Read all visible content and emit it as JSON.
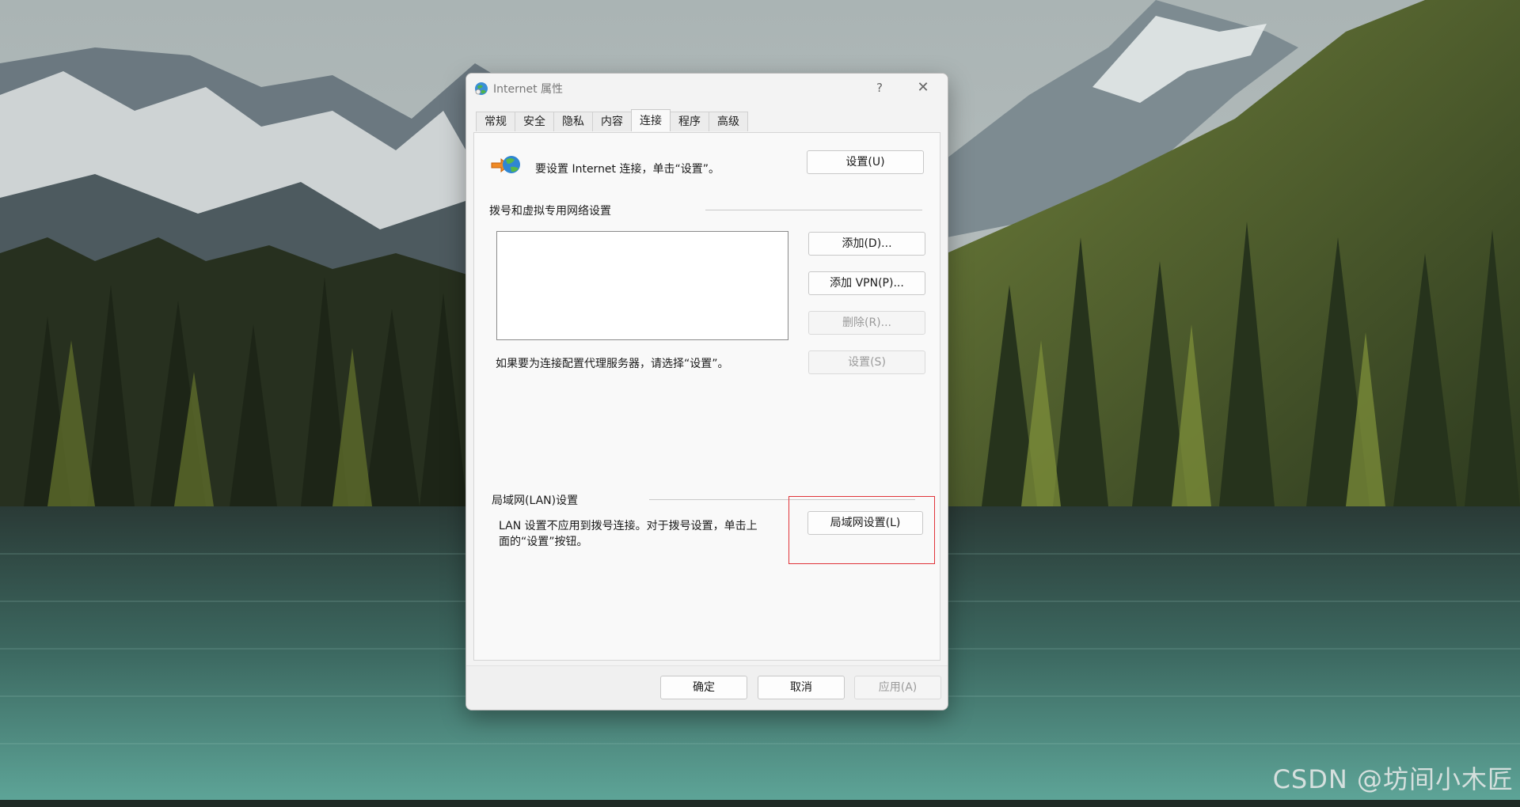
{
  "window": {
    "title": "Internet 属性",
    "help_label": "?",
    "close_label": "✕"
  },
  "tabs": [
    {
      "label": "常规"
    },
    {
      "label": "安全"
    },
    {
      "label": "隐私"
    },
    {
      "label": "内容"
    },
    {
      "label": "连接",
      "active": true
    },
    {
      "label": "程序"
    },
    {
      "label": "高级"
    }
  ],
  "connection": {
    "setup_text": "要设置 Internet 连接，单击“设置”。",
    "setup_button": "设置(U)"
  },
  "dialup": {
    "heading": "拨号和虚拟专用网络设置",
    "add_button": "添加(D)...",
    "add_vpn_button": "添加 VPN(P)...",
    "remove_button": "删除(R)...",
    "proxy_text": "如果要为连接配置代理服务器，请选择“设置”。",
    "settings_button": "设置(S)"
  },
  "lan": {
    "heading": "局域网(LAN)设置",
    "description_line1": "LAN 设置不应用到拨号连接。对于拨号设置，单击上",
    "description_line2": "面的“设置”按钮。",
    "lan_settings_button": "局域网设置(L)"
  },
  "footer": {
    "ok_button": "确定",
    "cancel_button": "取消",
    "apply_button": "应用(A)"
  },
  "watermark": "CSDN @坊间小木匠",
  "colors": {
    "highlight": "#e0353a",
    "dialog_bg": "#f3f3f3"
  }
}
